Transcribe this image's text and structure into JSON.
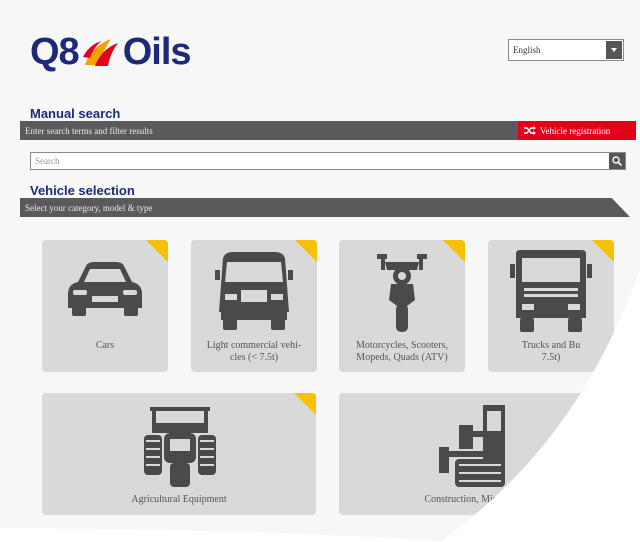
{
  "header": {
    "logo_text_left": "Q8",
    "logo_text_right": "Oils",
    "language": {
      "selected": "English"
    }
  },
  "manual_search": {
    "title": "Manual search",
    "subtitle": "Enter search terms and filter results",
    "registration_button": "Vehicle registration",
    "search_placeholder": "Search"
  },
  "vehicle_selection": {
    "title": "Vehicle selection",
    "subtitle": "Select your category, model & type",
    "categories": [
      {
        "label_line1": "Cars",
        "label_line2": "",
        "icon": "car-icon"
      },
      {
        "label_line1": "Light commercial vehi-",
        "label_line2": "cles (< 7.5t)",
        "icon": "van-icon"
      },
      {
        "label_line1": "Motorcycles, Scooters,",
        "label_line2": "Mopeds, Quads (ATV)",
        "icon": "motorcycle-icon"
      },
      {
        "label_line1": "Trucks and Bu",
        "label_line2": "7.5t)",
        "icon": "truck-icon"
      },
      {
        "label_line1": "Agricultural Equipment",
        "label_line2": "",
        "icon": "tractor-icon"
      },
      {
        "label_line1": "Construction, Mining and",
        "label_line2": "",
        "icon": "excavator-icon"
      }
    ]
  },
  "colors": {
    "brand_blue": "#1e2a78",
    "bar_gray": "#5a5a5c",
    "accent_red": "#e2001a",
    "corner_yellow": "#f5c100",
    "tile_gray": "#d9d9d9"
  }
}
